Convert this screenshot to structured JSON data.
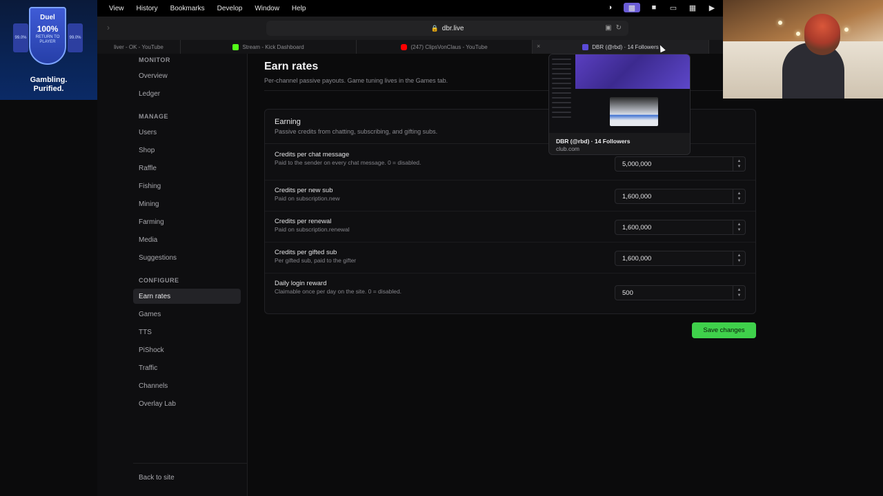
{
  "menubar": {
    "items": [
      "View",
      "History",
      "Bookmarks",
      "Develop",
      "Window",
      "Help"
    ]
  },
  "browser": {
    "url": "dbr.live",
    "tabs": [
      {
        "label": "liver - OK - YouTube",
        "favicon_color": "#ff0000"
      },
      {
        "label": "Stream - Kick Dashboard",
        "favicon_color": "#53fc18"
      },
      {
        "label": "(247) ClipsVonClaus - YouTube",
        "favicon_color": "#ff0000"
      },
      {
        "label": "DBR (@rbd) · 14 Followers",
        "favicon_color": "#5b4bd8"
      }
    ]
  },
  "sidebar": {
    "groups": {
      "monitor": "MONITOR",
      "manage": "MANAGE",
      "configure": "CONFIGURE"
    },
    "monitor_items": [
      "Overview",
      "Ledger"
    ],
    "manage_items": [
      "Users",
      "Shop",
      "Raffle",
      "Fishing",
      "Mining",
      "Farming",
      "Media",
      "Suggestions"
    ],
    "configure_items": [
      "Earn rates",
      "Games",
      "TTS",
      "PiShock",
      "Traffic",
      "Channels",
      "Overlay Lab"
    ],
    "active_item": "Earn rates",
    "back_link": "Back to site"
  },
  "page": {
    "title": "Earn rates",
    "subtitle": "Per-channel passive payouts. Game tuning lives in the Games tab.",
    "card": {
      "title": "Earning",
      "description": "Passive credits from chatting, subscribing, and gifting subs.",
      "rows": [
        {
          "label": "Credits per chat message",
          "help": "Paid to the sender on every chat message. 0 = disabled.",
          "value": "5,000,000"
        },
        {
          "label": "Credits per new sub",
          "help": "Paid on subscription.new",
          "value": "1,600,000"
        },
        {
          "label": "Credits per renewal",
          "help": "Paid on subscription.renewal",
          "value": "1,600,000"
        },
        {
          "label": "Credits per gifted sub",
          "help": "Per gifted sub, paid to the gifter",
          "value": "1,600,000"
        },
        {
          "label": "Daily login reward",
          "help": "Claimable once per day on the site. 0 = disabled.",
          "value": "500"
        }
      ]
    },
    "save_label": "Save changes",
    "accent_color": "#3fd14b"
  },
  "tab_preview": {
    "title": "DBR (@rbd) · 14 Followers",
    "host": "club.com"
  },
  "ad_overlay": {
    "brand": "Duel",
    "rtp": "100%",
    "rtp_caption": "RETURN TO PLAYER",
    "tagline_1": "Gambling.",
    "tagline_2": "Purified."
  }
}
